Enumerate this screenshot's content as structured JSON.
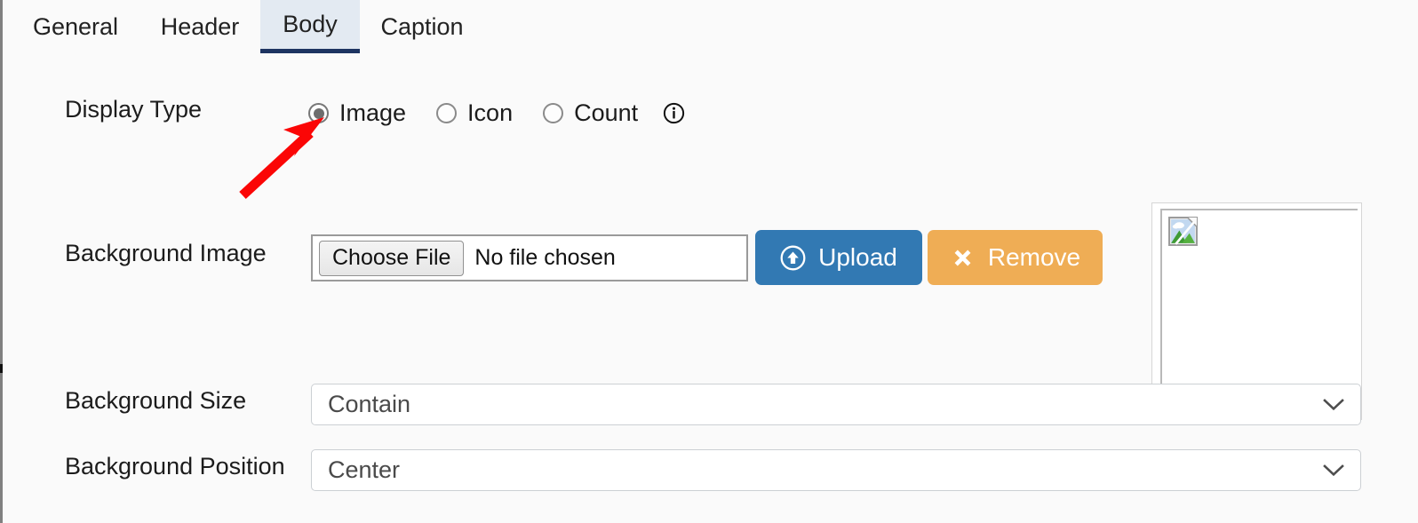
{
  "tabs": [
    {
      "label": "General",
      "active": false
    },
    {
      "label": "Header",
      "active": false
    },
    {
      "label": "Body",
      "active": true
    },
    {
      "label": "Caption",
      "active": false
    }
  ],
  "display_type": {
    "label": "Display Type",
    "options": [
      {
        "label": "Image",
        "selected": true
      },
      {
        "label": "Icon",
        "selected": false
      },
      {
        "label": "Count",
        "selected": false
      }
    ],
    "info_icon": "info-icon"
  },
  "background_image": {
    "label": "Background Image",
    "choose_file_label": "Choose File",
    "file_status": "No file chosen",
    "upload_label": "Upload",
    "upload_icon": "arrow-up-circle-icon",
    "remove_label": "Remove",
    "remove_icon": "close-x-icon"
  },
  "preview": {
    "icon": "broken-image-icon"
  },
  "background_size": {
    "label": "Background Size",
    "value": "Contain"
  },
  "background_position": {
    "label": "Background Position",
    "value": "Center"
  },
  "annotation": {
    "type": "red-arrow",
    "points_to": "Image radio button",
    "color": "#fb0606"
  },
  "colors": {
    "page_background": "#fafafa",
    "active_tab_background": "#e3eaf2",
    "active_tab_underline": "#1d3461",
    "upload_button": "#3279b3",
    "remove_button": "#efad55",
    "annotation_red": "#fb0606"
  }
}
